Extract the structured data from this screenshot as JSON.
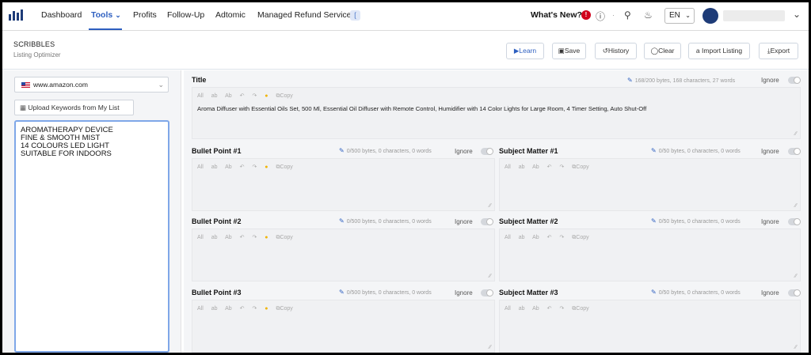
{
  "nav": {
    "items": [
      "Dashboard",
      "Tools",
      "Profits",
      "Follow-Up",
      "Adtomic",
      "Managed Refund Service"
    ],
    "active": "Tools",
    "whats_new": "What's New?",
    "notification_count": "!",
    "language": "EN",
    "avatar_initials": "",
    "accent": "#2d5fc0"
  },
  "header": {
    "title": "SCRIBBLES",
    "subtitle": "Listing Optimizer",
    "buttons": {
      "learn": "Learn",
      "save": "Save",
      "history": "History",
      "clear": "Clear",
      "import": "Import Listing",
      "export": "Export"
    }
  },
  "left": {
    "marketplace": "www.amazon.com",
    "upload_label": "Upload Keywords from My List",
    "keywords": "AROMATHERAPY DEVICE\nFINE & SMOOTH MIST\n14 COLOURS LED LIGHT\nSUITABLE FOR INDOORS"
  },
  "editor": {
    "toolbar": {
      "all": "All",
      "lower": "ab",
      "title_case": "Ab",
      "copy": "Copy"
    },
    "ignore_label": "Ignore",
    "title": {
      "label": "Title",
      "meta": "168/200 bytes, 168 characters, 27 words",
      "value": "Aroma Diffuser with Essential Oils Set, 500 Ml, Essential Oil Diffuser with Remote Control, Humidifier with 14 Color Lights for Large Room, 4 Timer Setting, Auto Shut-Off"
    },
    "bullets": [
      {
        "label": "Bullet Point #1",
        "meta": "0/500 bytes, 0 characters, 0 words"
      },
      {
        "label": "Bullet Point #2",
        "meta": "0/500 bytes, 0 characters, 0 words"
      },
      {
        "label": "Bullet Point #3",
        "meta": "0/500 bytes, 0 characters, 0 words"
      }
    ],
    "subjects": [
      {
        "label": "Subject Matter #1",
        "meta": "0/50 bytes, 0 characters, 0 words"
      },
      {
        "label": "Subject Matter #2",
        "meta": "0/50 bytes, 0 characters, 0 words"
      },
      {
        "label": "Subject Matter #3",
        "meta": "0/50 bytes, 0 characters, 0 words"
      }
    ]
  }
}
